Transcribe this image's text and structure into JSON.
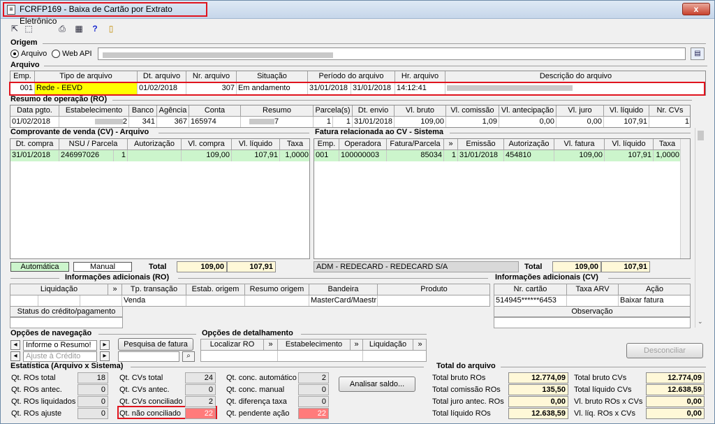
{
  "window": {
    "title": "FCRFP169 - Baixa de Cartão por Extrato Eletrônico",
    "close_label": "x"
  },
  "toolbar": {
    "icons": [
      "arrow-icon",
      "cursor-icon",
      "printer-icon",
      "calculator-icon",
      "help-icon",
      "exit-door-icon"
    ]
  },
  "origem": {
    "label": "Origem",
    "radio_arquivo": "Arquivo",
    "radio_webapi": "Web API"
  },
  "arquivo": {
    "label": "Arquivo",
    "headers": [
      "Emp.",
      "Tipo de arquivo",
      "Dt. arquivo",
      "Nr. arquivo",
      "Situação",
      "Período do arquivo",
      "Hr. arquivo",
      "Descrição do arquivo"
    ],
    "row": {
      "emp": "001",
      "tipo": "Rede - EEVD",
      "dt": "01/02/2018",
      "nr": "307",
      "situacao": "Em andamento",
      "periodo_ini": "31/01/2018",
      "periodo_fim": "31/01/2018",
      "hr": "14:12:41"
    }
  },
  "ro": {
    "label": "Resumo de operação (RO)",
    "headers": [
      "Data pgto.",
      "Estabelecimento",
      "Banco",
      "Agência",
      "Conta",
      "Resumo",
      "Parcela(s)",
      "Dt. envio",
      "Vl. bruto",
      "Vl. comissão",
      "Vl. antecipação",
      "Vl. juro",
      "Vl. líquido",
      "Nr. CVs"
    ],
    "row": {
      "data": "01/02/2018",
      "estab": "2",
      "banco": "341",
      "agencia": "367",
      "conta": "165974",
      "resumo": "7",
      "parc1": "1",
      "parc2": "1",
      "envio": "31/01/2018",
      "bruto": "109,00",
      "comissao": "1,09",
      "antecip": "0,00",
      "juro": "0,00",
      "liquido": "107,91",
      "cvs": "1"
    }
  },
  "cv": {
    "label": "Comprovante de venda (CV) - Arquivo",
    "headers": [
      "Dt. compra",
      "NSU / Parcela",
      "Autorização",
      "Vl. compra",
      "Vl. líquido",
      "Taxa"
    ],
    "row": {
      "dt": "31/01/2018",
      "nsu": "246997026",
      "parcela": "1",
      "autorizacao": "",
      "compra": "109,00",
      "liquido": "107,91",
      "taxa": "1,0000"
    },
    "btn_auto": "Automática",
    "btn_manual": "Manual",
    "total_label": "Total",
    "total_compra": "109,00",
    "total_liquido": "107,91"
  },
  "fatura": {
    "label": "Fatura relacionada ao CV - Sistema",
    "headers": [
      "Emp.",
      "Operadora",
      "Fatura/Parcela",
      "»",
      "Emissão",
      "Autorização",
      "Vl. fatura",
      "Vl. líquido",
      "Taxa"
    ],
    "row": {
      "emp": "001",
      "operadora": "100000003",
      "fatura": "85034",
      "parcela": "1",
      "emissao": "31/01/2018",
      "autorizacao": "454810",
      "vfatura": "109,00",
      "liquido": "107,91",
      "taxa": "1,0000"
    },
    "adm": "ADM - REDECARD - REDECARD S/A",
    "total_label": "Total",
    "total_fatura": "109,00",
    "total_liquido": "107,91"
  },
  "info_ro": {
    "label": "Informações adicionais (RO)",
    "headers": [
      "Liquidação",
      "»",
      "Tp. transação",
      "Estab. origem",
      "Resumo origem",
      "Bandeira",
      "Produto"
    ],
    "tp": "Venda",
    "bandeira": "MasterCard/Maestr",
    "status_label": "Status do crédito/pagamento"
  },
  "info_cv": {
    "label": "Informações adicionais (CV)",
    "headers": [
      "Nr. cartão",
      "Taxa ARV",
      "Ação"
    ],
    "cartao": "514945******6453",
    "acao": "Baixar fatura",
    "obs_label": "Observação"
  },
  "nav": {
    "label": "Opções de navegação",
    "input1": "Informe o Resumo!",
    "input2": "Ajuste à Crédito",
    "pesquisa": "Pesquisa de fatura"
  },
  "detail": {
    "label": "Opções de detalhamento",
    "cols": [
      "Localizar RO",
      "»",
      "Estabelecimento",
      "»",
      "Liquidação",
      "»"
    ]
  },
  "desconciliar": "Desconciliar",
  "stats": {
    "label": "Estatística (Arquivo x Sistema)",
    "col1": [
      {
        "label": "Qt. ROs total",
        "value": "18"
      },
      {
        "label": "Qt. ROs antec.",
        "value": "0"
      },
      {
        "label": "Qt. ROs liquidados",
        "value": "0"
      },
      {
        "label": "Qt. ROs ajuste",
        "value": "0"
      }
    ],
    "col2": [
      {
        "label": "Qt. CVs total",
        "value": "24"
      },
      {
        "label": "Qt. CVs antec.",
        "value": "0"
      },
      {
        "label": "Qt. CVs conciliado",
        "value": "2"
      },
      {
        "label": "Qt. não conciliado",
        "value": "22"
      }
    ],
    "col3": [
      {
        "label": "Qt. conc. automático",
        "value": "2"
      },
      {
        "label": "Qt. conc. manual",
        "value": "0"
      },
      {
        "label": "Qt. diferença taxa",
        "value": "0"
      },
      {
        "label": "Qt. pendente ação",
        "value": "22"
      }
    ],
    "analisar": "Analisar saldo..."
  },
  "totals": {
    "label": "Total do arquivo",
    "left": [
      {
        "label": "Total bruto ROs",
        "value": "12.774,09"
      },
      {
        "label": "Total comissão ROs",
        "value": "135,50"
      },
      {
        "label": "Total juro antec. ROs",
        "value": "0,00"
      },
      {
        "label": "Total líquido ROs",
        "value": "12.638,59"
      }
    ],
    "right": [
      {
        "label": "Total bruto CVs",
        "value": "12.774,09"
      },
      {
        "label": "Total líquido CVs",
        "value": "12.638,59"
      },
      {
        "label": "Vl. bruto ROs x CVs",
        "value": "0,00"
      },
      {
        "label": "Vl. líq. ROs x CVs",
        "value": "0,00"
      }
    ]
  }
}
